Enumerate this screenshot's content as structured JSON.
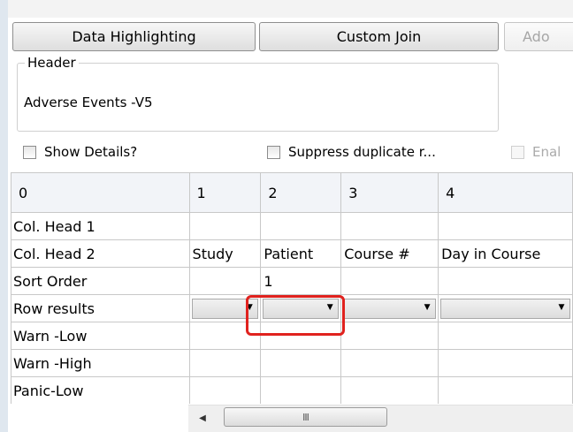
{
  "toolbar": {
    "data_highlighting": "Data Highlighting",
    "custom_join": "Custom Join",
    "add_partial": "Ado"
  },
  "header_group": {
    "legend": "Header",
    "value": "Adverse Events -V5"
  },
  "options": {
    "show_details": "Show Details?",
    "suppress_duplicates": "Suppress duplicate r...",
    "enable_partial": "Enal"
  },
  "grid": {
    "column_numbers": [
      "0",
      "1",
      "2",
      "3",
      "4"
    ],
    "rows": [
      {
        "label": "Col. Head 1",
        "cells": [
          "",
          "",
          "",
          ""
        ]
      },
      {
        "label": "Col. Head 2",
        "cells": [
          "Study",
          "Patient",
          "Course #",
          "Day in Course"
        ]
      },
      {
        "label": "Sort Order",
        "cells": [
          "",
          "1",
          "",
          ""
        ]
      },
      {
        "label": "Row results",
        "cells": [
          "",
          "",
          "",
          ""
        ]
      },
      {
        "label": "Warn -Low",
        "cells": [
          "",
          "",
          "",
          ""
        ]
      },
      {
        "label": "Warn -High",
        "cells": [
          "",
          "",
          "",
          ""
        ]
      },
      {
        "label": "Panic-Low",
        "cells": [
          "",
          "",
          "",
          ""
        ]
      }
    ]
  },
  "icons": {
    "dropdown": "chevron-down-icon",
    "scroll_left": "arrow-left-icon",
    "thumb_grip": "grip-icon"
  },
  "scrollbar": {
    "grip": "III"
  },
  "colors": {
    "highlight": "#e0221e"
  }
}
